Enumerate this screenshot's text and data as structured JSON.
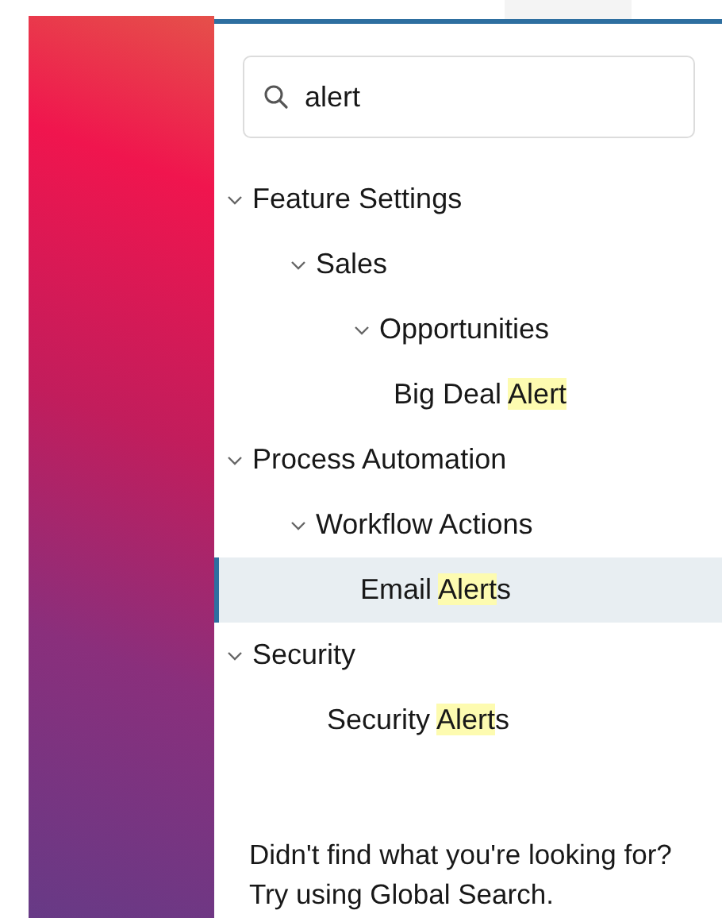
{
  "search": {
    "value": "alert"
  },
  "tree": [
    {
      "parts": [
        {
          "text": "Feature Settings",
          "highlighted": false
        }
      ],
      "expanded": true,
      "selected": false,
      "children": [
        {
          "parts": [
            {
              "text": "Sales",
              "highlighted": false
            }
          ],
          "expanded": true,
          "selected": false,
          "children": [
            {
              "parts": [
                {
                  "text": "Opportunities",
                  "highlighted": false
                }
              ],
              "expanded": true,
              "selected": false,
              "children": [
                {
                  "parts": [
                    {
                      "text": "Big Deal ",
                      "highlighted": false
                    },
                    {
                      "text": "Alert",
                      "highlighted": true
                    }
                  ],
                  "selected": false
                }
              ]
            }
          ]
        }
      ]
    },
    {
      "parts": [
        {
          "text": "Process Automation",
          "highlighted": false
        }
      ],
      "expanded": true,
      "selected": false,
      "children": [
        {
          "parts": [
            {
              "text": "Workflow Actions",
              "highlighted": false
            }
          ],
          "expanded": true,
          "selected": false,
          "children": [
            {
              "parts": [
                {
                  "text": "Email ",
                  "highlighted": false
                },
                {
                  "text": "Alert",
                  "highlighted": true
                },
                {
                  "text": "s",
                  "highlighted": false
                }
              ],
              "selected": true
            }
          ]
        }
      ]
    },
    {
      "parts": [
        {
          "text": "Security",
          "highlighted": false
        }
      ],
      "expanded": true,
      "selected": false,
      "children": [
        {
          "parts": [
            {
              "text": "Security ",
              "highlighted": false
            },
            {
              "text": "Alert",
              "highlighted": true
            },
            {
              "text": "s",
              "highlighted": false
            }
          ],
          "selected": false
        }
      ]
    }
  ],
  "footer": [
    "Didn't find what you're looking for?",
    "Try using Global Search."
  ]
}
